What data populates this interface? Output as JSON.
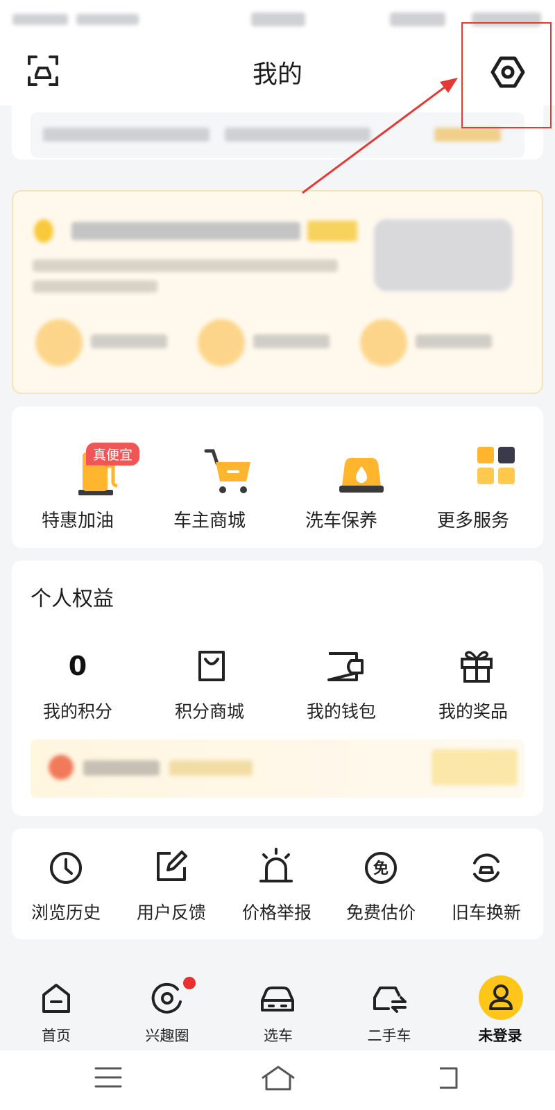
{
  "header": {
    "title": "我的"
  },
  "services": [
    {
      "label": "特惠加油",
      "badge": "真便宜"
    },
    {
      "label": "车主商城"
    },
    {
      "label": "洗车保养"
    },
    {
      "label": "更多服务"
    }
  ],
  "benefits": {
    "title": "个人权益",
    "points_value": "0",
    "items": [
      {
        "label": "我的积分"
      },
      {
        "label": "积分商城"
      },
      {
        "label": "我的钱包"
      },
      {
        "label": "我的奖品"
      }
    ]
  },
  "tools": [
    {
      "label": "浏览历史"
    },
    {
      "label": "用户反馈"
    },
    {
      "label": "价格举报"
    },
    {
      "label": "免费估价"
    },
    {
      "label": "旧车换新"
    }
  ],
  "bottom_nav": [
    {
      "label": "首页"
    },
    {
      "label": "兴趣圈"
    },
    {
      "label": "选车"
    },
    {
      "label": "二手车"
    },
    {
      "label": "未登录"
    }
  ],
  "colors": {
    "accent": "#ffc61a",
    "badge_red": "#f25555",
    "annotation_red": "#e53935"
  },
  "icons": {
    "header_left": "scan-icon",
    "header_right": "settings-icon"
  }
}
